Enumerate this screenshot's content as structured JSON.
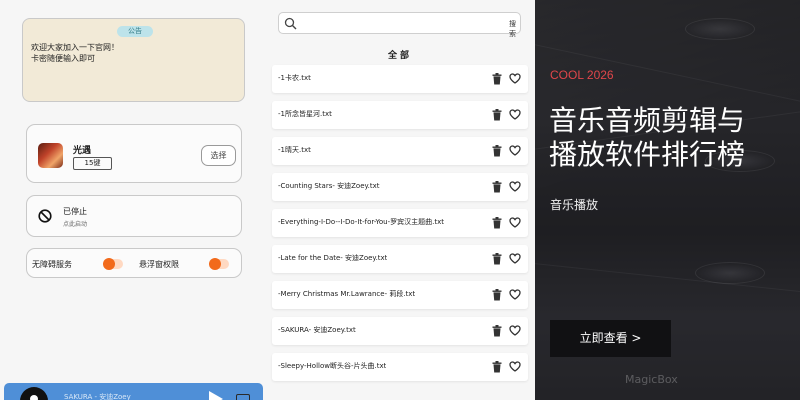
{
  "left": {
    "notice": {
      "badge": "公告",
      "text": "欢迎大家加入一下官网！\n卡密随便输入即可"
    },
    "app": {
      "name": "光遇",
      "key_label": "15键",
      "select_label": "选择"
    },
    "status": {
      "title": "已停止",
      "subtitle": "点此启动"
    },
    "toggles": [
      {
        "label": "无障碍服务",
        "on": true
      },
      {
        "label": "悬浮窗权限",
        "on": true
      }
    ],
    "player": {
      "title": "SAKURA - 安迪Zoey"
    }
  },
  "middle": {
    "search": {
      "placeholder": "",
      "button_label": "搜索"
    },
    "list_title": "全部",
    "files": [
      "-1卡农.txt",
      "-1所念皆星河.txt",
      "-1晴天.txt",
      "-Counting Stars- 安迪Zoey.txt",
      "-Everything-I-Do--I-Do-It-for-You-罗宾汉主题曲.txt",
      "-Late for the Date- 安迪Zoey.txt",
      "-Merry Christmas Mr.Lawrance- 莉段.txt",
      "-SAKURA- 安迪Zoey.txt",
      "-Sleepy-Hollow断头谷-片头曲.txt"
    ]
  },
  "right": {
    "tag": "COOL 2026",
    "headline": "音乐音频剪辑与\n播放软件排行榜",
    "subline": "音乐播放",
    "cta": "立即查看 >",
    "watermark": "MagicBox"
  },
  "colors": {
    "accent_orange": "#f26a1b",
    "tag_red": "#e0464a",
    "player_blue": "#4f8fd7"
  }
}
